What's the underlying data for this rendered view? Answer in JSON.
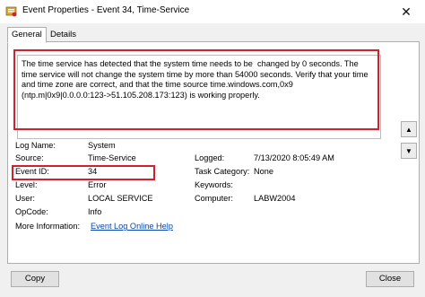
{
  "window": {
    "title": "Event Properties - Event 34, Time-Service",
    "close_glyph": "✕"
  },
  "tabs": [
    {
      "label": "General"
    },
    {
      "label": "Details"
    }
  ],
  "description": "The time service has detected that the system time needs to be  changed by 0 seconds. The time service will not change the system time by more than 54000 seconds. Verify that your time and time zone are correct, and that the time source time.windows.com,0x9 (ntp.m|0x9|0.0.0.0:123->51.105.208.173:123) is working properly.",
  "fields": {
    "log_name": {
      "label": "Log Name:",
      "value": "System"
    },
    "source": {
      "label": "Source:",
      "value": "Time-Service"
    },
    "logged": {
      "label": "Logged:",
      "value": "7/13/2020 8:05:49 AM"
    },
    "event_id": {
      "label": "Event ID:",
      "value": "34"
    },
    "task_category": {
      "label": "Task Category:",
      "value": "None"
    },
    "level": {
      "label": "Level:",
      "value": "Error"
    },
    "keywords": {
      "label": "Keywords:",
      "value": ""
    },
    "user": {
      "label": "User:",
      "value": "LOCAL SERVICE"
    },
    "computer": {
      "label": "Computer:",
      "value": "LABW2004"
    },
    "opcode": {
      "label": "OpCode:",
      "value": "Info"
    },
    "more_info": {
      "label": "More Information:",
      "value": "Event Log Online Help"
    }
  },
  "buttons": {
    "copy": "Copy",
    "close": "Close"
  },
  "icons": {
    "up": "▲",
    "down": "▼"
  },
  "colors": {
    "highlight": "#d3202f",
    "link": "#0645ad"
  }
}
